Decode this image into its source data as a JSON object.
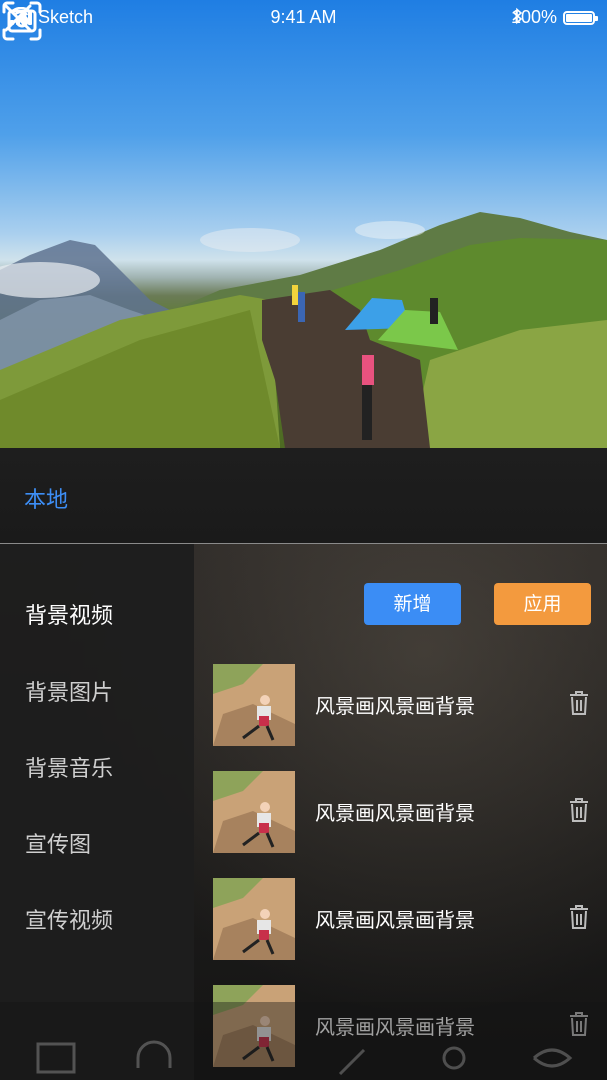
{
  "status_bar": {
    "carrier": "Sketch",
    "time": "9:41 AM",
    "battery": "100%"
  },
  "header": {
    "close_icon": "close-icon",
    "camera_flip_icon": "camera-flip-icon"
  },
  "tabs": {
    "active_label": "本地"
  },
  "sidebar": {
    "items": [
      {
        "label": "背景视频",
        "active": true
      },
      {
        "label": "背景图片",
        "active": false
      },
      {
        "label": "背景音乐",
        "active": false
      },
      {
        "label": "宣传图",
        "active": false
      },
      {
        "label": "宣传视频",
        "active": false
      }
    ]
  },
  "actions": {
    "add_label": "新增",
    "apply_label": "应用"
  },
  "list": {
    "items": [
      {
        "title": "风景画风景画背景",
        "icon": "trash-icon"
      },
      {
        "title": "风景画风景画背景",
        "icon": "trash-icon"
      },
      {
        "title": "风景画风景画背景",
        "icon": "trash-icon"
      },
      {
        "title": "风景画风景画背景",
        "icon": "trash-icon"
      }
    ]
  },
  "colors": {
    "accent_blue": "#3b8df5",
    "accent_orange": "#f39a3e",
    "tab_blue": "#3d8ef5"
  }
}
